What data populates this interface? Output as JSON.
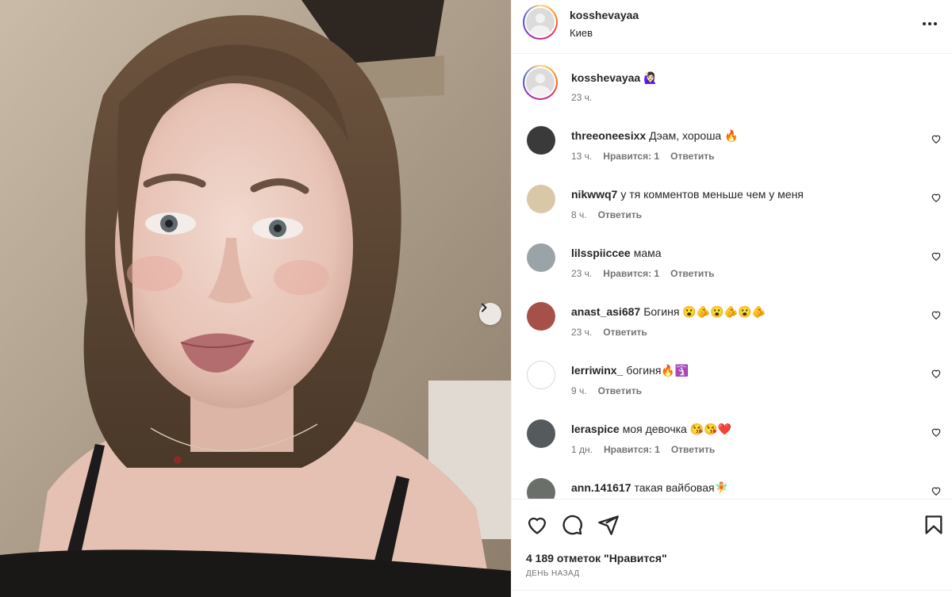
{
  "post": {
    "author": "kosshevayaa",
    "location": "Киев"
  },
  "caption": {
    "username": "kosshevayaa",
    "emoji": "🙋🏻‍♀️",
    "time": "23 ч."
  },
  "comments": [
    {
      "username": "threeoneesixx",
      "text": "Дэам, хороша 🔥",
      "time": "13 ч.",
      "likes": "Нравится: 1",
      "reply": "Ответить",
      "avatar_color": "#3a3a3a"
    },
    {
      "username": "nikwwq7",
      "text": "у тя комментов меньше чем у меня",
      "time": "8 ч.",
      "likes": "",
      "reply": "Ответить",
      "avatar_color": "#d9c7a8"
    },
    {
      "username": "lilsspiiccee",
      "text": "мама",
      "time": "23 ч.",
      "likes": "Нравится: 1",
      "reply": "Ответить",
      "avatar_color": "#9aa4a8"
    },
    {
      "username": "anast_asi687",
      "text": "Богиня 😮🫵😮🫵😮🫵",
      "time": "23 ч.",
      "likes": "",
      "reply": "Ответить",
      "avatar_color": "#a6504a"
    },
    {
      "username": "lerriwinx_",
      "text": "богиня🔥🛐",
      "time": "9 ч.",
      "likes": "",
      "reply": "Ответить",
      "avatar_color": "#ffffff"
    },
    {
      "username": "leraspice",
      "text": "моя девочка 😘😘❤️",
      "time": "1 дн.",
      "likes": "Нравится: 1",
      "reply": "Ответить",
      "avatar_color": "#555a5c"
    },
    {
      "username": "ann.141617",
      "text": "такая вайбовая🧚",
      "time": "",
      "likes": "",
      "reply": "",
      "avatar_color": "#6b6f6a"
    }
  ],
  "actions": {
    "likes_count": "4 189 отметок \"Нравится\"",
    "date": "день назад"
  },
  "colors": {
    "text": "#262626",
    "secondary": "#737373",
    "border": "#efefef"
  }
}
